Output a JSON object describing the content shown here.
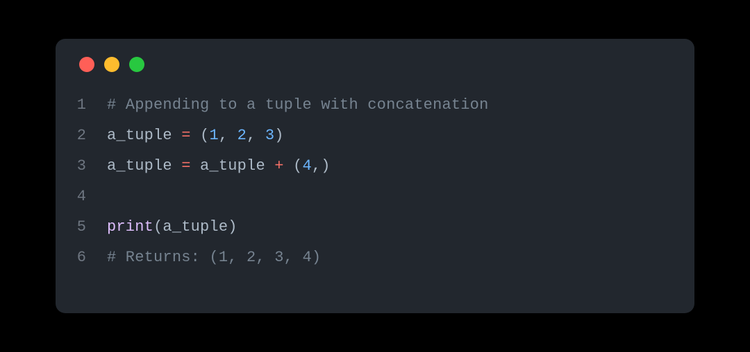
{
  "window": {
    "traffic_lights": {
      "close": {
        "name": "close",
        "color": "#ff5f57"
      },
      "minimize": {
        "name": "minimize",
        "color": "#febc2e"
      },
      "zoom": {
        "name": "zoom",
        "color": "#28c840"
      }
    }
  },
  "code": {
    "line_numbers": [
      "1",
      "2",
      "3",
      "4",
      "5",
      "6"
    ],
    "lines": [
      [
        {
          "t": "# Appending to a tuple with concatenation",
          "c": "tok-comment"
        }
      ],
      [
        {
          "t": "a_tuple ",
          "c": "tok-ident"
        },
        {
          "t": "=",
          "c": "tok-op"
        },
        {
          "t": " (",
          "c": "tok-punc"
        },
        {
          "t": "1",
          "c": "tok-num"
        },
        {
          "t": ", ",
          "c": "tok-punc"
        },
        {
          "t": "2",
          "c": "tok-num"
        },
        {
          "t": ", ",
          "c": "tok-punc"
        },
        {
          "t": "3",
          "c": "tok-num"
        },
        {
          "t": ")",
          "c": "tok-punc"
        }
      ],
      [
        {
          "t": "a_tuple ",
          "c": "tok-ident"
        },
        {
          "t": "=",
          "c": "tok-op"
        },
        {
          "t": " a_tuple ",
          "c": "tok-ident"
        },
        {
          "t": "+",
          "c": "tok-op"
        },
        {
          "t": " (",
          "c": "tok-punc"
        },
        {
          "t": "4",
          "c": "tok-num"
        },
        {
          "t": ",)",
          "c": "tok-punc"
        }
      ],
      [
        {
          "t": "",
          "c": "tok-ident"
        }
      ],
      [
        {
          "t": "print",
          "c": "tok-func"
        },
        {
          "t": "(a_tuple)",
          "c": "tok-punc"
        }
      ],
      [
        {
          "t": "# Returns: (1, 2, 3, 4)",
          "c": "tok-comment"
        }
      ]
    ]
  }
}
